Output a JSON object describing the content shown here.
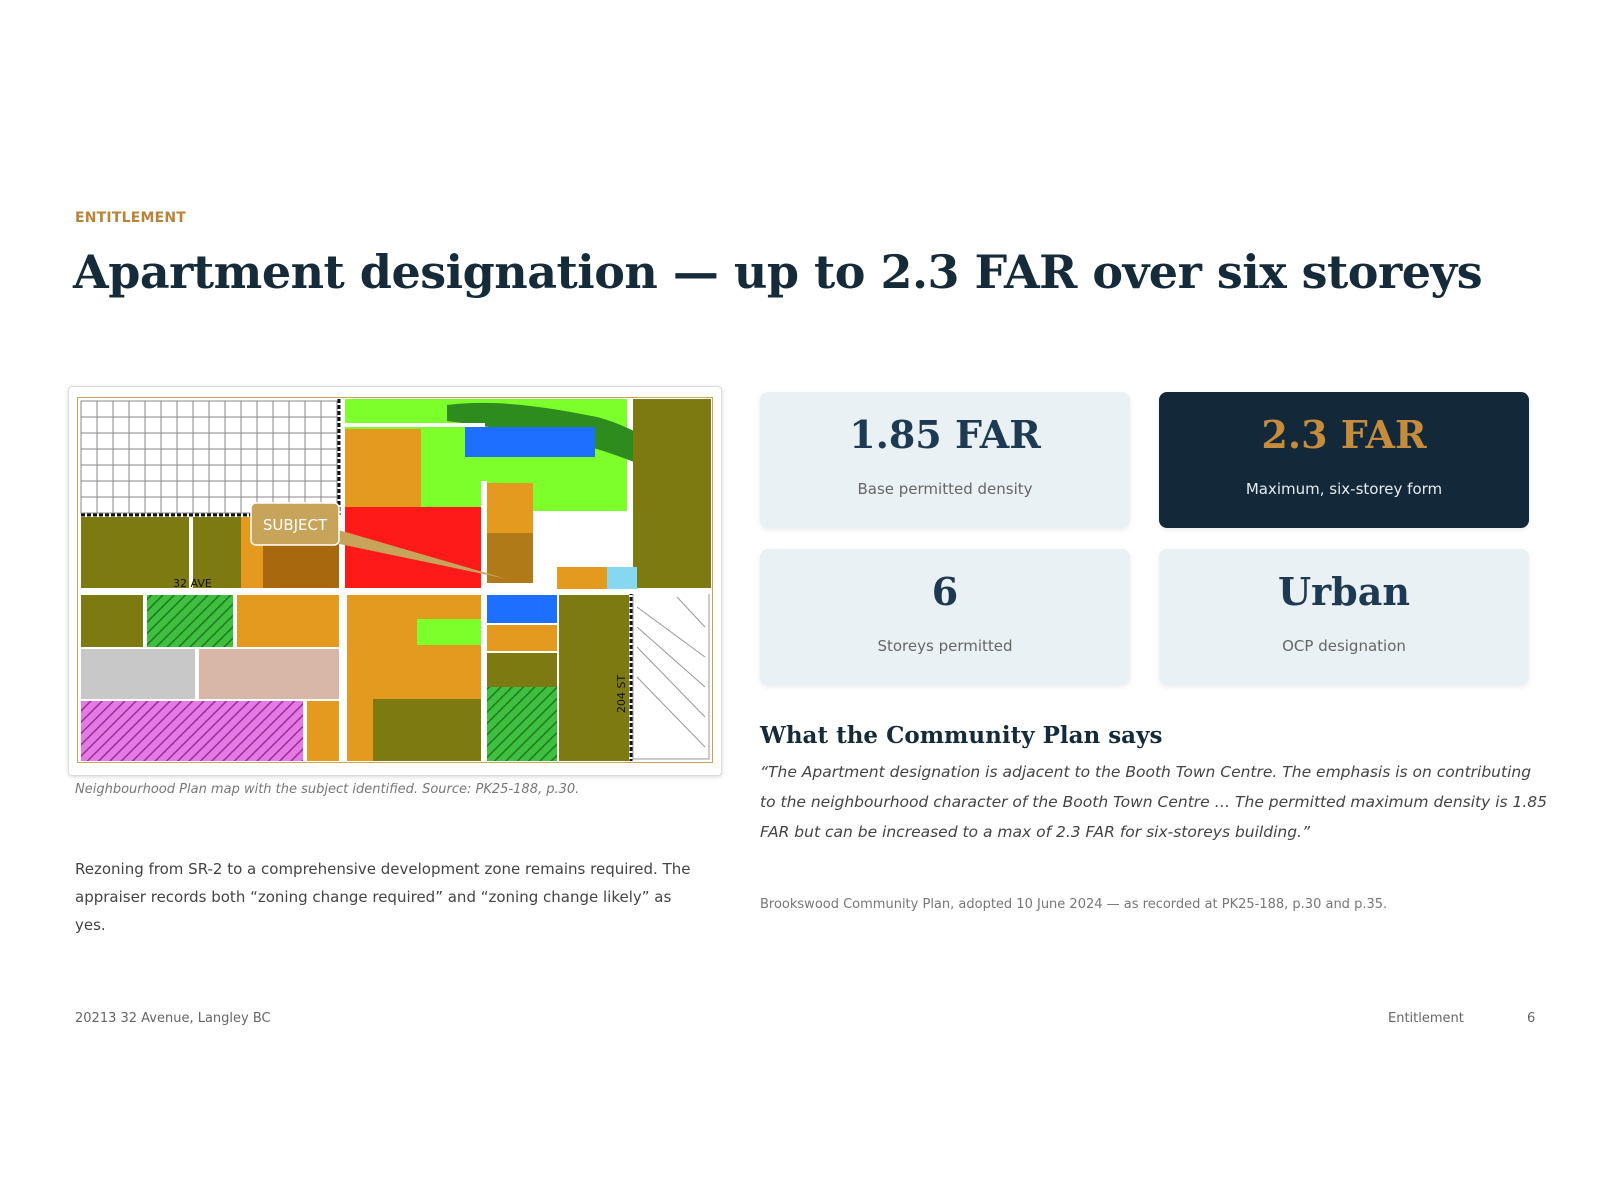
{
  "header": {
    "eyebrow": "ENTITLEMENT",
    "title": "Apartment designation — up to 2.3 FAR over six storeys"
  },
  "map": {
    "caption": "Neighbourhood Plan map with the subject identified. Source: PK25-188, p.30.",
    "labels": {
      "subject": "SUBJECT",
      "avenue": "32 AVE",
      "street": "204 ST"
    },
    "colors": {
      "apartment_orange": "#e39a1f",
      "subject_red": "#ff1a1a",
      "park_green": "#7cff2a",
      "trail_green": "#2e8b1e",
      "water_blue": "#1e6fff",
      "olive": "#7d7a12",
      "accent_gold": "#c8a45a",
      "magenta_hatch": "#d84fd8"
    }
  },
  "body_text": "Rezoning from SR-2 to a comprehensive development zone remains required. The appraiser records both “zoning change required” and “zoning change likely” as yes.",
  "stats": [
    {
      "value": "1.85 FAR",
      "label": "Base permitted density",
      "highlight": false
    },
    {
      "value": "2.3 FAR",
      "label": "Maximum, six-storey form",
      "highlight": true
    },
    {
      "value": "6",
      "label": "Storeys permitted",
      "highlight": false
    },
    {
      "value": "Urban",
      "label": "OCP designation",
      "highlight": false
    }
  ],
  "community_plan": {
    "heading": "What the Community Plan says",
    "quote": "“The Apartment designation is adjacent to the Booth Town Centre. The emphasis is on contributing to the neighbourhood character of the Booth Town Centre … The permitted maximum density is 1.85 FAR but can be increased to a max of 2.3 FAR for six-storeys building.”",
    "source": "Brookswood Community Plan, adopted 10 June 2024 — as recorded at PK25-188, p.30 and p.35."
  },
  "footer": {
    "address": "20213 32 Avenue, Langley BC",
    "section": "Entitlement",
    "page": "6"
  },
  "theme": {
    "navy": "#152b3a",
    "gold": "#b8843a",
    "card_bg": "#eaf1f4"
  }
}
